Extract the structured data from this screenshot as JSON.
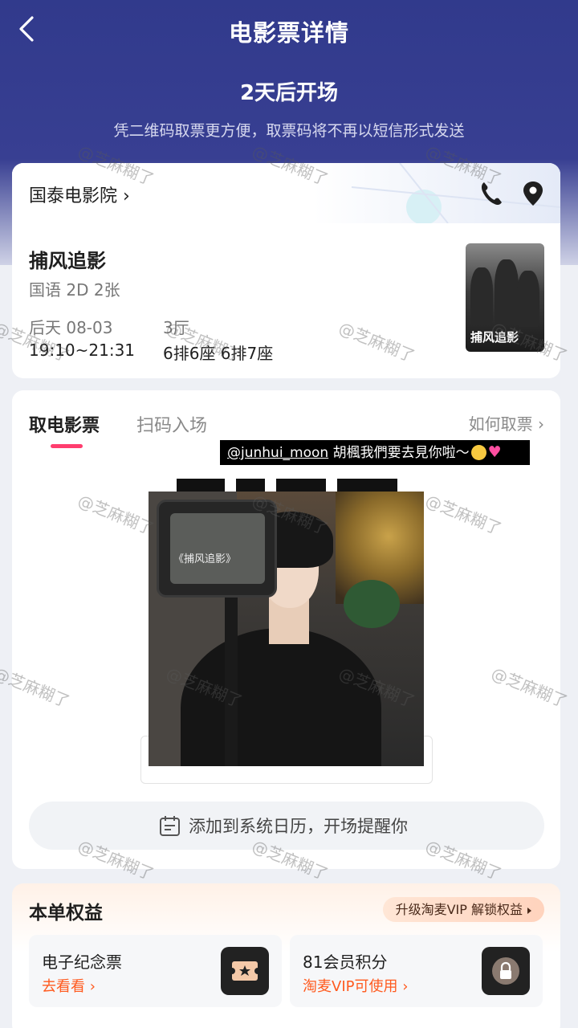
{
  "header": {
    "title": "电影票详情",
    "countdown": "2天后开场",
    "hint": "凭二维码取票更方便，取票码将不再以短信形式发送"
  },
  "cinema": {
    "name": "国泰电影院 ›"
  },
  "movie": {
    "title": "捕风追影",
    "meta": "国语 2D 2张",
    "day": "后天 08-03",
    "time": "19:10~21:31",
    "hall": "3厅",
    "seats": "6排6座 6排7座",
    "poster_title": "捕风追影"
  },
  "ticket": {
    "tab_active": "取电影票",
    "tab_inactive": "扫码入场",
    "howto": "如何取票 ›",
    "sticker_handle": "@junhui_moon",
    "sticker_text": " 胡楓我們要去見你啦～",
    "photo_sign": "《捕风追影》",
    "calendar_label": "添加到系统日历，开场提醒你"
  },
  "benefits": {
    "title": "本单权益",
    "vip_button": "升级淘麦VIP 解锁权益",
    "items": [
      {
        "name": "电子纪念票",
        "link": "去看看 ›"
      },
      {
        "name": "81会员积分",
        "link": "淘麦VIP可使用 ›"
      }
    ]
  },
  "watermark": "@芝麻糊了",
  "colors": {
    "brand": "#333b8f",
    "accent": "#ff3d6e",
    "link": "#ff5a1e"
  }
}
